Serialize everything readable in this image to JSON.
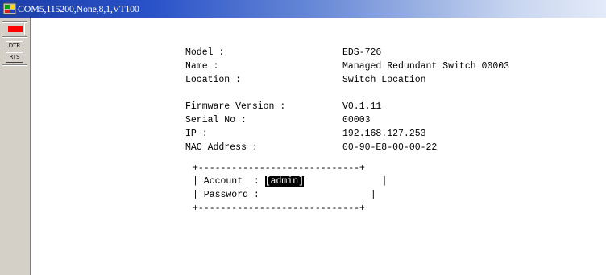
{
  "window": {
    "title": "COM5,115200,None,8,1,VT100"
  },
  "side_panel": {
    "dtr_label": "DTR",
    "rts_label": "RTS"
  },
  "terminal": {
    "info": [
      {
        "label": "Model :",
        "value": "EDS-726"
      },
      {
        "label": "Name :",
        "value": "Managed Redundant Switch 00003"
      },
      {
        "label": "Location :",
        "value": "Switch Location"
      },
      {
        "label": "Firmware Version :",
        "value": "V0.1.11"
      },
      {
        "label": "Serial No :",
        "value": "00003"
      },
      {
        "label": "IP :",
        "value": "192.168.127.253"
      },
      {
        "label": "MAC Address :",
        "value": "00-90-E8-00-00-22"
      }
    ],
    "login_box": {
      "border_top": "+-----------------------------+",
      "account_prefix": "| Account  : ",
      "account_value": "[admin]",
      "account_suffix": "              |",
      "password_line": "| Password :                    |",
      "border_bottom": "+-----------------------------+"
    }
  }
}
